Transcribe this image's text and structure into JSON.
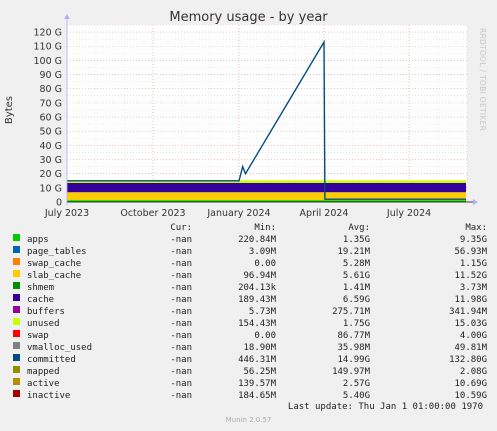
{
  "chart_data": {
    "type": "area",
    "title": "Memory usage - by year",
    "ylabel": "Bytes",
    "side_label": "RRDTOOL / TOBI OETIKER",
    "ylim": [
      0,
      125
    ],
    "yticks": [
      {
        "v": 0,
        "label": "0"
      },
      {
        "v": 10,
        "label": "10 G"
      },
      {
        "v": 20,
        "label": "20 G"
      },
      {
        "v": 30,
        "label": "30 G"
      },
      {
        "v": 40,
        "label": "40 G"
      },
      {
        "v": 50,
        "label": "50 G"
      },
      {
        "v": 60,
        "label": "60 G"
      },
      {
        "v": 70,
        "label": "70 G"
      },
      {
        "v": 80,
        "label": "80 G"
      },
      {
        "v": 90,
        "label": "90 G"
      },
      {
        "v": 100,
        "label": "100 G"
      },
      {
        "v": 110,
        "label": "110 G"
      },
      {
        "v": 120,
        "label": "120 G"
      }
    ],
    "xlim": [
      "2023-07-01",
      "2024-09-01"
    ],
    "xticks": [
      {
        "date": "2023-07-01",
        "label": "July 2023"
      },
      {
        "date": "2023-10-01",
        "label": "October 2023"
      },
      {
        "date": "2024-01-01",
        "label": "January 2024"
      },
      {
        "date": "2024-04-01",
        "label": "April 2024"
      },
      {
        "date": "2024-07-01",
        "label": "July 2024"
      }
    ],
    "series": [
      {
        "name": "apps",
        "color": "#00cc00",
        "cur": "-nan",
        "min": "220.84M",
        "avg": "1.35G",
        "max": "9.35G"
      },
      {
        "name": "page_tables",
        "color": "#0066b3",
        "cur": "-nan",
        "min": "3.09M",
        "avg": "19.21M",
        "max": "56.93M"
      },
      {
        "name": "swap_cache",
        "color": "#ff8000",
        "cur": "-nan",
        "min": "0.00",
        "avg": "5.28M",
        "max": "1.15G"
      },
      {
        "name": "slab_cache",
        "color": "#ffcc00",
        "cur": "-nan",
        "min": "96.94M",
        "avg": "5.61G",
        "max": "11.52G"
      },
      {
        "name": "shmem",
        "color": "#008f00",
        "cur": "-nan",
        "min": "204.13k",
        "avg": "1.41M",
        "max": "3.73M"
      },
      {
        "name": "cache",
        "color": "#330099",
        "cur": "-nan",
        "min": "189.43M",
        "avg": "6.59G",
        "max": "11.98G"
      },
      {
        "name": "buffers",
        "color": "#990099",
        "cur": "-nan",
        "min": "5.73M",
        "avg": "275.71M",
        "max": "341.94M"
      },
      {
        "name": "unused",
        "color": "#ccff00",
        "cur": "-nan",
        "min": "154.43M",
        "avg": "1.75G",
        "max": "15.03G"
      },
      {
        "name": "swap",
        "color": "#ff0000",
        "cur": "-nan",
        "min": "0.00",
        "avg": "86.77M",
        "max": "4.00G"
      },
      {
        "name": "vmalloc_used",
        "color": "#808080",
        "cur": "-nan",
        "min": "18.90M",
        "avg": "35.98M",
        "max": "49.81M"
      },
      {
        "name": "committed",
        "color": "#004d80",
        "cur": "-nan",
        "min": "446.31M",
        "avg": "14.99G",
        "max": "132.80G"
      },
      {
        "name": "mapped",
        "color": "#8f8f00",
        "cur": "-nan",
        "min": "56.25M",
        "avg": "149.97M",
        "max": "2.08G"
      },
      {
        "name": "active",
        "color": "#b38f00",
        "cur": "-nan",
        "min": "139.57M",
        "avg": "2.57G",
        "max": "10.69G"
      },
      {
        "name": "inactive",
        "color": "#a00000",
        "cur": "-nan",
        "min": "184.65M",
        "avg": "5.40G",
        "max": "10.59G"
      }
    ],
    "stack": {
      "start": "2023-07-01",
      "end": "2024-08-31",
      "typical_values": [
        {
          "series": "apps",
          "value": 1.3
        },
        {
          "series": "slab_cache",
          "value": 5.6
        },
        {
          "series": "cache",
          "value": 6.6
        },
        {
          "series": "unused",
          "value": 1.8
        }
      ]
    },
    "committed_line": {
      "points": [
        {
          "date": "2023-07-01",
          "value": 15
        },
        {
          "date": "2024-01-01",
          "value": 15
        },
        {
          "date": "2024-01-05",
          "value": 25
        },
        {
          "date": "2024-01-08",
          "value": 20
        },
        {
          "date": "2024-04-01",
          "value": 113
        },
        {
          "date": "2024-04-02",
          "value": 2
        },
        {
          "date": "2024-08-31",
          "value": 2
        }
      ]
    }
  },
  "legend_header": {
    "cur": "Cur:",
    "min": "Min:",
    "avg": "Avg:",
    "max": "Max:"
  },
  "last_update": "Last update: Thu Jan  1 01:00:00 1970",
  "footer": "Munin 2.0.57"
}
